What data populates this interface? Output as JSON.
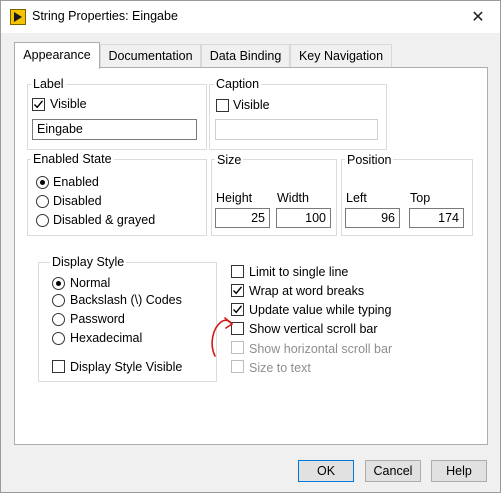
{
  "window": {
    "title": "String Properties: Eingabe",
    "close_glyph": "✕"
  },
  "tabs": [
    {
      "label": "Appearance",
      "active": true
    },
    {
      "label": "Documentation",
      "active": false
    },
    {
      "label": "Data Binding",
      "active": false
    },
    {
      "label": "Key Navigation",
      "active": false
    }
  ],
  "label_group": {
    "title": "Label",
    "visible_label": "Visible",
    "visible_checked": true,
    "value": "Eingabe"
  },
  "caption_group": {
    "title": "Caption",
    "visible_label": "Visible",
    "visible_checked": false,
    "value": ""
  },
  "enabled_state": {
    "title": "Enabled State",
    "options": [
      {
        "label": "Enabled",
        "selected": true
      },
      {
        "label": "Disabled",
        "selected": false
      },
      {
        "label": "Disabled & grayed",
        "selected": false
      }
    ]
  },
  "size": {
    "title": "Size",
    "height_label": "Height",
    "width_label": "Width",
    "height": "25",
    "width": "100"
  },
  "position": {
    "title": "Position",
    "left_label": "Left",
    "top_label": "Top",
    "left": "96",
    "top": "174"
  },
  "display_style": {
    "title": "Display Style",
    "options": [
      {
        "label": "Normal",
        "selected": true
      },
      {
        "label": "Backslash (\\) Codes",
        "selected": false
      },
      {
        "label": "Password",
        "selected": false
      },
      {
        "label": "Hexadecimal",
        "selected": false
      }
    ],
    "visible_label": "Display Style Visible",
    "visible_checked": false
  },
  "options": [
    {
      "label": "Limit to single line",
      "checked": false,
      "enabled": true
    },
    {
      "label": "Wrap at word breaks",
      "checked": true,
      "enabled": true
    },
    {
      "label": "Update value while typing",
      "checked": true,
      "enabled": true
    },
    {
      "label": "Show vertical scroll bar",
      "checked": false,
      "enabled": true
    },
    {
      "label": "Show horizontal scroll bar",
      "checked": false,
      "enabled": false
    },
    {
      "label": "Size to text",
      "checked": false,
      "enabled": false
    }
  ],
  "buttons": {
    "ok": "OK",
    "cancel": "Cancel",
    "help": "Help"
  },
  "colors": {
    "accent": "#0078d7",
    "annotation": "#d01919",
    "disabled_text": "#8e8e8e"
  }
}
